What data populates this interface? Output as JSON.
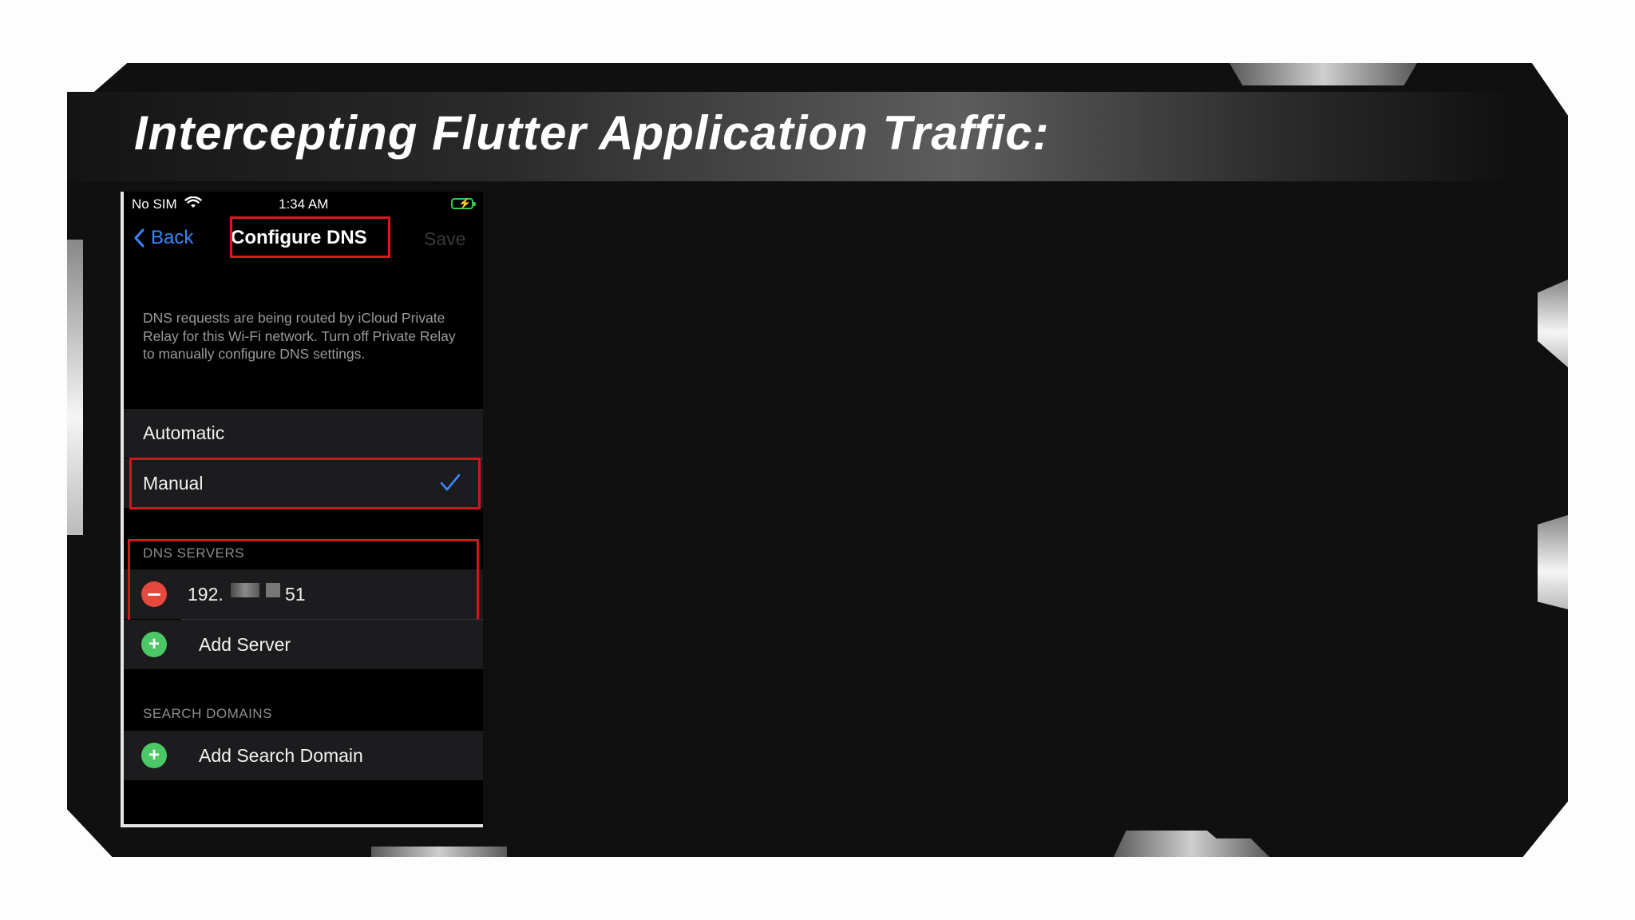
{
  "slide": {
    "title": "Intercepting Flutter Application Traffic:"
  },
  "status_bar": {
    "carrier": "No SIM",
    "time": "1:34 AM"
  },
  "nav": {
    "back_label": "Back",
    "title": "Configure DNS",
    "save_label": "Save"
  },
  "note": "DNS requests are being routed by iCloud Private Relay for this Wi-Fi network. Turn off Private Relay to manually configure DNS settings.",
  "dns_mode": {
    "options": [
      {
        "label": "Automatic",
        "selected": false
      },
      {
        "label": "Manual",
        "selected": true
      }
    ]
  },
  "dns_servers": {
    "section_label": "DNS SERVERS",
    "server_prefix": "192.",
    "server_suffix": "51",
    "add_label": "Add Server"
  },
  "search_domains": {
    "section_label": "SEARCH DOMAINS",
    "add_label": "Add Search Domain"
  },
  "colors": {
    "accent_blue": "#3a86ff",
    "highlight_red": "#d3151c",
    "add_green": "#34c759",
    "remove_red": "#ff453a"
  }
}
